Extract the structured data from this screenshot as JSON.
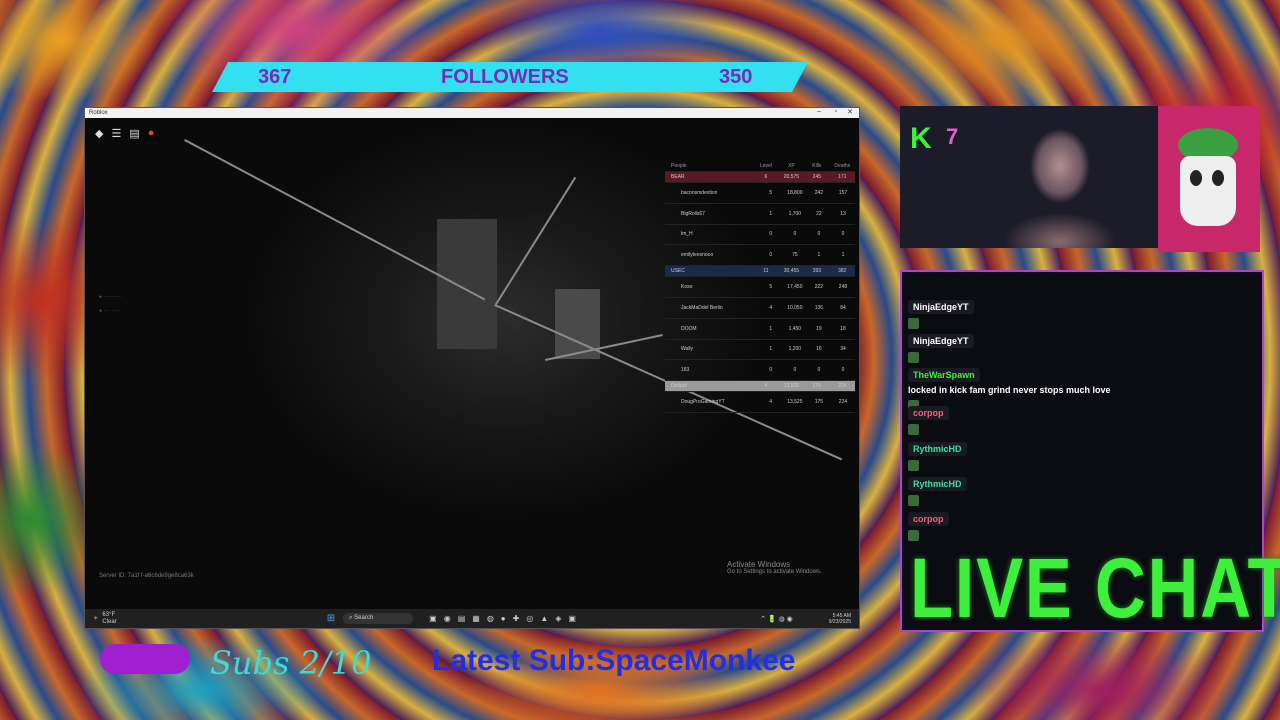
{
  "banner": {
    "left_count": "367",
    "title": "FOLLOWERS",
    "right_count": "350"
  },
  "window": {
    "title": "Roblox"
  },
  "scoreboard": {
    "columns": [
      "People",
      "Level",
      "XP",
      "Kills",
      "Deaths"
    ],
    "rows": [
      {
        "type": "team",
        "cells": [
          "BEAR",
          "6",
          "20,575",
          "245",
          "171"
        ],
        "color": "#5a1a24"
      },
      {
        "type": "player",
        "cells": [
          "baconsmdestion",
          "5",
          "18,800",
          "242",
          "157"
        ]
      },
      {
        "type": "player",
        "cells": [
          "BigRolls67",
          "1",
          "1,700",
          "22",
          "13"
        ]
      },
      {
        "type": "player",
        "cells": [
          "lm_H",
          "0",
          "0",
          "0",
          "0"
        ]
      },
      {
        "type": "player",
        "cells": [
          "emilyteesnooo",
          "0",
          "75",
          "1",
          "1"
        ]
      },
      {
        "type": "team",
        "cells": [
          "USEC",
          "11",
          "30,455",
          "393",
          "382"
        ],
        "color": "#1a2a4a"
      },
      {
        "type": "player",
        "cells": [
          "Koso",
          "5",
          "17,450",
          "222",
          "248"
        ]
      },
      {
        "type": "player",
        "cells": [
          "JackMaDdel Berlin",
          "4",
          "10,050",
          "136",
          "84"
        ]
      },
      {
        "type": "player",
        "cells": [
          "DOOM",
          "1",
          "1,450",
          "19",
          "18"
        ]
      },
      {
        "type": "player",
        "cells": [
          "Wally",
          "1",
          "1,200",
          "16",
          "34"
        ]
      },
      {
        "type": "player",
        "cells": [
          "183",
          "0",
          "0",
          "0",
          "0"
        ]
      },
      {
        "type": "team",
        "cells": [
          "Default",
          "4",
          "13,525",
          "175",
          "224"
        ],
        "color": "#9a9a9a"
      },
      {
        "type": "player",
        "cells": [
          "DougProGamingYT",
          "4",
          "13,525",
          "175",
          "224"
        ]
      }
    ]
  },
  "server_id": "Server ID: 7a1f f-a6c6de9ge8ca63k",
  "activate": {
    "line1": "Activate Windows",
    "line2": "Go to Settings to activate Windows."
  },
  "taskbar": {
    "weather_temp": "63°F",
    "weather_cond": "Clear",
    "search_label": "Search",
    "time": "5:45 AM",
    "date": "9/23/2025"
  },
  "kick": {
    "logo": "K",
    "count": "7"
  },
  "chat": {
    "messages": [
      {
        "user": "NinjaEdgeYT",
        "text": "",
        "color": "#ffffff"
      },
      {
        "user": "NinjaEdgeYT",
        "text": "",
        "color": "#ffffff"
      },
      {
        "user": "TheWarSpawn",
        "text": "locked in kick fam grind never stops much love",
        "color": "#3cf03c"
      },
      {
        "user": "corpop",
        "text": "",
        "color": "#ff5a7a"
      },
      {
        "user": "RythmicHD",
        "text": "",
        "color": "#3ce0a0"
      },
      {
        "user": "RythmicHD",
        "text": "",
        "color": "#3ce0a0"
      },
      {
        "user": "corpop",
        "text": "",
        "color": "#ff5a7a"
      }
    ]
  },
  "live_chat": "LIVE CHAT",
  "subs": "Subs 2/10",
  "latest_sub": "Latest Sub:SpaceMonkee"
}
